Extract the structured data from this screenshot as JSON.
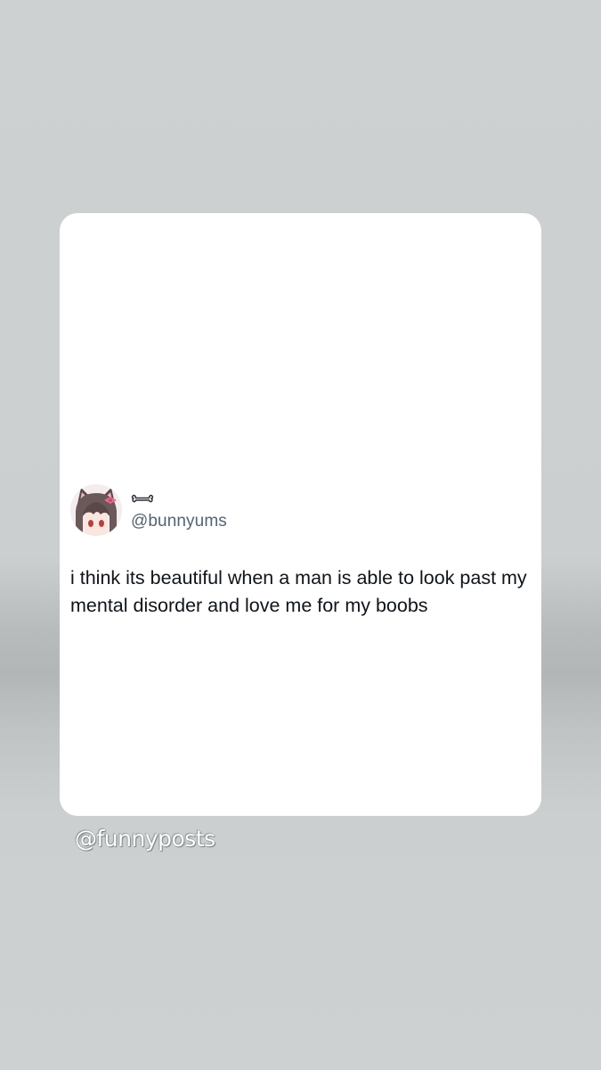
{
  "tweet": {
    "display_name_icon": "bone-icon",
    "handle": "@bunnyums",
    "text": "i think its beautiful when a man is able to look past my mental disorder and love me for my boobs",
    "avatar": "anime-cat-girl-avatar"
  },
  "watermark": "@funnyposts",
  "colors": {
    "background": "#cdd1d1",
    "card": "#ffffff",
    "handle": "#536471",
    "text": "#0f1419"
  }
}
